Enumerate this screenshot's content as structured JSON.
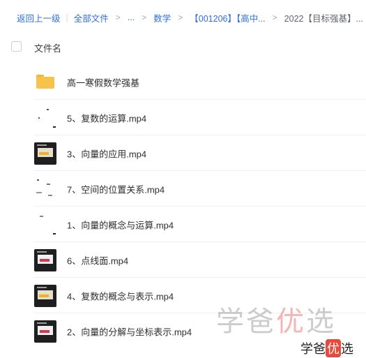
{
  "breadcrumb": {
    "back": "返回上一级",
    "items": [
      "全部文件",
      "...",
      "数学",
      "【001206】【高中...",
      "2022【目标强基】..."
    ]
  },
  "list_header": {
    "name_label": "文件名"
  },
  "files": [
    {
      "name": "高一寒假数学强基",
      "icon": "folder-icon"
    },
    {
      "name": "5、复数的运算.mp4",
      "icon": "video-thumbnail-blank"
    },
    {
      "name": "3、向量的应用.mp4",
      "icon": "video-thumbnail-dark"
    },
    {
      "name": "7、空间的位置关系.mp4",
      "icon": "video-thumbnail-blank"
    },
    {
      "name": "1、向量的概念与运算.mp4",
      "icon": "video-thumbnail-blank"
    },
    {
      "name": "6、点线面.mp4",
      "icon": "video-thumbnail-dark"
    },
    {
      "name": "4、复数的概念与表示.mp4",
      "icon": "video-thumbnail-dark"
    },
    {
      "name": "2、向量的分解与坐标表示.mp4",
      "icon": "video-thumbnail-dark"
    }
  ],
  "watermark": {
    "text_plain_1": "学爸",
    "text_accent": "优",
    "text_plain_2": "选"
  },
  "colors": {
    "link": "#2f6fe0",
    "folder": "#f8c34a",
    "divider": "#eef0f3"
  }
}
